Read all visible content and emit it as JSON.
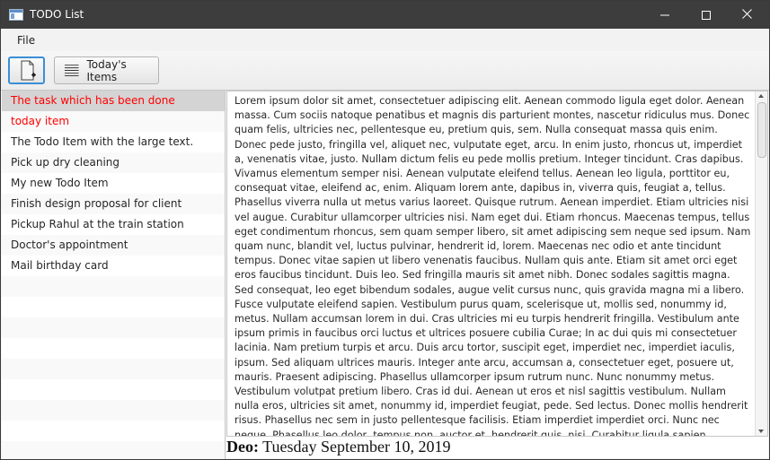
{
  "window": {
    "title": "TODO List",
    "controls": [
      "minimize",
      "maximize",
      "close"
    ]
  },
  "menubar": {
    "items": [
      {
        "label": "File"
      }
    ]
  },
  "toolbar": {
    "new_item_icon": "new-document-icon",
    "today_label": "Today's Items",
    "today_icon": "list-lines-icon"
  },
  "todo_list": {
    "items": [
      {
        "label": "The task which has been done",
        "selected": true,
        "color": "#ff0000"
      },
      {
        "label": "today item",
        "color": "#ff0000"
      },
      {
        "label": "The Todo Item with the large text."
      },
      {
        "label": "Pick up dry cleaning"
      },
      {
        "label": "My new Todo Item"
      },
      {
        "label": "Finish design proposal for client"
      },
      {
        "label": "Pickup Rahul at the train station"
      },
      {
        "label": "Doctor's appointment"
      },
      {
        "label": "Mail birthday card"
      }
    ]
  },
  "details": {
    "text": "Lorem ipsum dolor sit amet, consectetuer adipiscing elit. Aenean commodo ligula eget dolor. Aenean massa. Cum sociis natoque penatibus et magnis dis parturient montes, nascetur ridiculus mus. Donec quam felis, ultricies nec, pellentesque eu, pretium quis, sem. Nulla consequat massa quis enim. Donec pede justo, fringilla vel, aliquet nec, vulputate eget, arcu. In enim justo, rhoncus ut, imperdiet a, venenatis vitae, justo. Nullam dictum felis eu pede mollis pretium. Integer tincidunt. Cras dapibus. Vivamus elementum semper nisi. Aenean vulputate eleifend tellus. Aenean leo ligula, porttitor eu, consequat vitae, eleifend ac, enim. Aliquam lorem ante, dapibus in, viverra quis, feugiat a, tellus. Phasellus viverra nulla ut metus varius laoreet. Quisque rutrum. Aenean imperdiet. Etiam ultricies nisi vel augue. Curabitur ullamcorper ultricies nisi. Nam eget dui. Etiam rhoncus. Maecenas tempus, tellus eget condimentum rhoncus, sem quam semper libero, sit amet adipiscing sem neque sed ipsum. Nam quam nunc, blandit vel, luctus pulvinar, hendrerit id, lorem. Maecenas nec odio et ante tincidunt tempus. Donec vitae sapien ut libero venenatis faucibus. Nullam quis ante. Etiam sit amet orci eget eros faucibus tincidunt. Duis leo. Sed fringilla mauris sit amet nibh. Donec sodales sagittis magna. Sed consequat, leo eget bibendum sodales, augue velit cursus nunc, quis gravida magna mi a libero. Fusce vulputate eleifend sapien. Vestibulum purus quam, scelerisque ut, mollis sed, nonummy id, metus. Nullam accumsan lorem in dui. Cras ultricies mi eu turpis hendrerit fringilla. Vestibulum ante ipsum primis in faucibus orci luctus et ultrices posuere cubilia Curae; In ac dui quis mi consectetuer lacinia. Nam pretium turpis et arcu. Duis arcu tortor, suscipit eget, imperdiet nec, imperdiet iaculis, ipsum. Sed aliquam ultrices mauris. Integer ante arcu, accumsan a, consectetuer eget, posuere ut, mauris. Praesent adipiscing. Phasellus ullamcorper ipsum rutrum nunc. Nunc nonummy metus. Vestibulum volutpat pretium libero. Cras id dui. Aenean ut eros et nisl sagittis vestibulum. Nullam nulla eros, ultricies sit amet, nonummy id, imperdiet feugiat, pede. Sed lectus. Donec mollis hendrerit risus. Phasellus nec sem in justo pellentesque facilisis. Etiam imperdiet imperdiet orci. Nunc nec neque. Phasellus leo dolor, tempus non, auctor et, hendrerit quis, nisi. Curabitur ligula sapien, tincidunt non, euismod vitae, posuere imperdiet, leo. Maecenas"
  },
  "deadline": {
    "label": "Deo:",
    "value": "Tuesday September 10, 2019"
  },
  "colors": {
    "titlebar": "#3d3d3d",
    "done_item": "#ff0000",
    "selection": "#d4d4d4",
    "focus_border": "#3a8fd6"
  }
}
